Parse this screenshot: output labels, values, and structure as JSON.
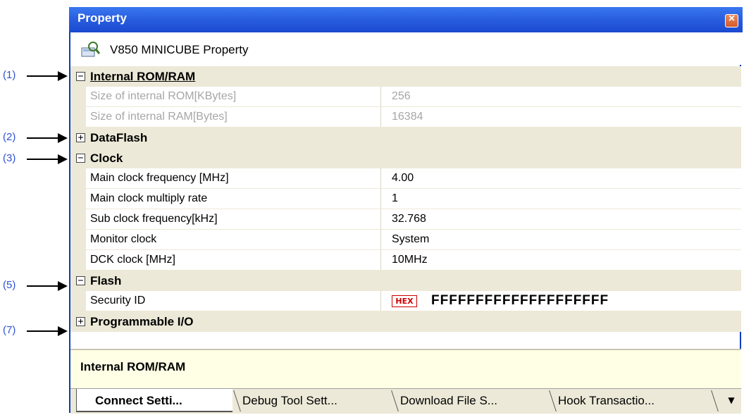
{
  "window": {
    "title": "Property",
    "subheader": "V850 MINICUBE Property",
    "close_glyph": "×",
    "close_icon": "close-icon",
    "properties_icon": "properties-icon"
  },
  "callouts": [
    "(1)",
    "(2)",
    "(3)",
    "(5)",
    "(7)"
  ],
  "categories": {
    "internal_rom_ram": {
      "label": "Internal ROM/RAM",
      "expander": "−",
      "rows": [
        {
          "name": "Size of internal ROM[KBytes]",
          "value": "256"
        },
        {
          "name": "Size of internal RAM[Bytes]",
          "value": "16384"
        }
      ]
    },
    "dataflash": {
      "label": "DataFlash",
      "expander": "+"
    },
    "clock": {
      "label": "Clock",
      "expander": "−",
      "rows": [
        {
          "name": "Main clock frequency [MHz]",
          "value": "4.00"
        },
        {
          "name": "Main clock multiply rate",
          "value": "1"
        },
        {
          "name": "Sub clock frequency[kHz]",
          "value": "32.768"
        },
        {
          "name": "Monitor clock",
          "value": "System"
        },
        {
          "name": "DCK clock [MHz]",
          "value": "10MHz"
        }
      ]
    },
    "flash": {
      "label": "Flash",
      "expander": "−",
      "rows": [
        {
          "name": "Security ID",
          "badge": "HEX",
          "value": "FFFFFFFFFFFFFFFFFFFF"
        }
      ]
    },
    "programmable_io": {
      "label": "Programmable I/O",
      "expander": "+"
    }
  },
  "description": {
    "text": "Internal ROM/RAM"
  },
  "tabs": [
    {
      "label": "Connect Setti...",
      "active": true
    },
    {
      "label": "Debug Tool Sett...",
      "active": false
    },
    {
      "label": "Download File S...",
      "active": false
    },
    {
      "label": "Hook Transactio...",
      "active": false
    }
  ],
  "overflow_glyph": "▼",
  "overflow_icon": "tab-overflow-icon",
  "colors": {
    "titlebar": "#2a5fe0",
    "callout_text": "#2f52d6",
    "category_bg": "#ece9d8",
    "description_bg": "#ffffe6",
    "hex_badge": "#cc0000"
  }
}
